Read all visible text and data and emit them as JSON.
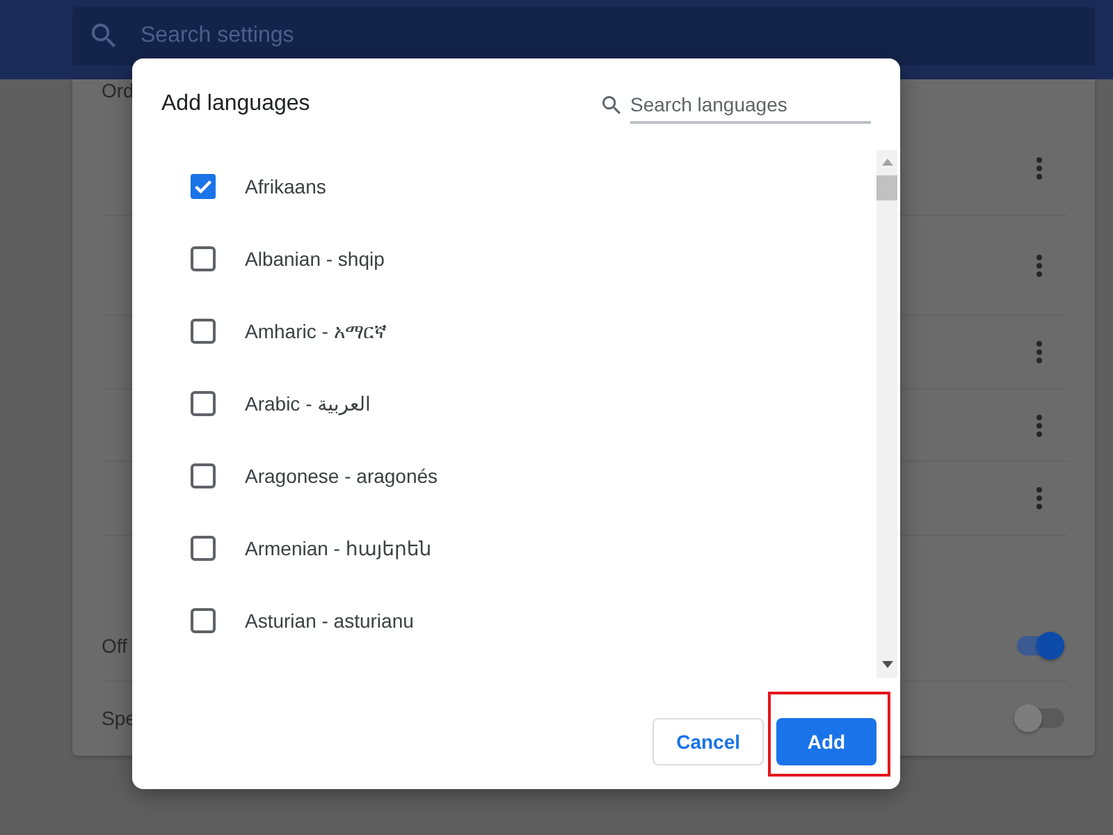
{
  "header": {
    "search": {
      "placeholder": "Search settings"
    }
  },
  "settings": {
    "heading": "Ord",
    "toggle_rows": [
      {
        "label": "Off",
        "on": true
      },
      {
        "label": "Spe",
        "on": false
      }
    ]
  },
  "dialog": {
    "title": "Add languages",
    "search": {
      "placeholder": "Search languages"
    },
    "languages": [
      {
        "label": "Afrikaans",
        "checked": true
      },
      {
        "label": "Albanian - shqip",
        "checked": false
      },
      {
        "label": "Amharic - አማርኛ",
        "checked": false
      },
      {
        "label": "Arabic - العربية",
        "checked": false
      },
      {
        "label": "Aragonese - aragonés",
        "checked": false
      },
      {
        "label": "Armenian - հայերեն",
        "checked": false
      },
      {
        "label": "Asturian - asturianu",
        "checked": false
      }
    ],
    "buttons": [
      {
        "label": "Cancel",
        "kind": "secondary",
        "highlighted": false
      },
      {
        "label": "Add",
        "kind": "primary",
        "highlighted": true
      }
    ]
  }
}
